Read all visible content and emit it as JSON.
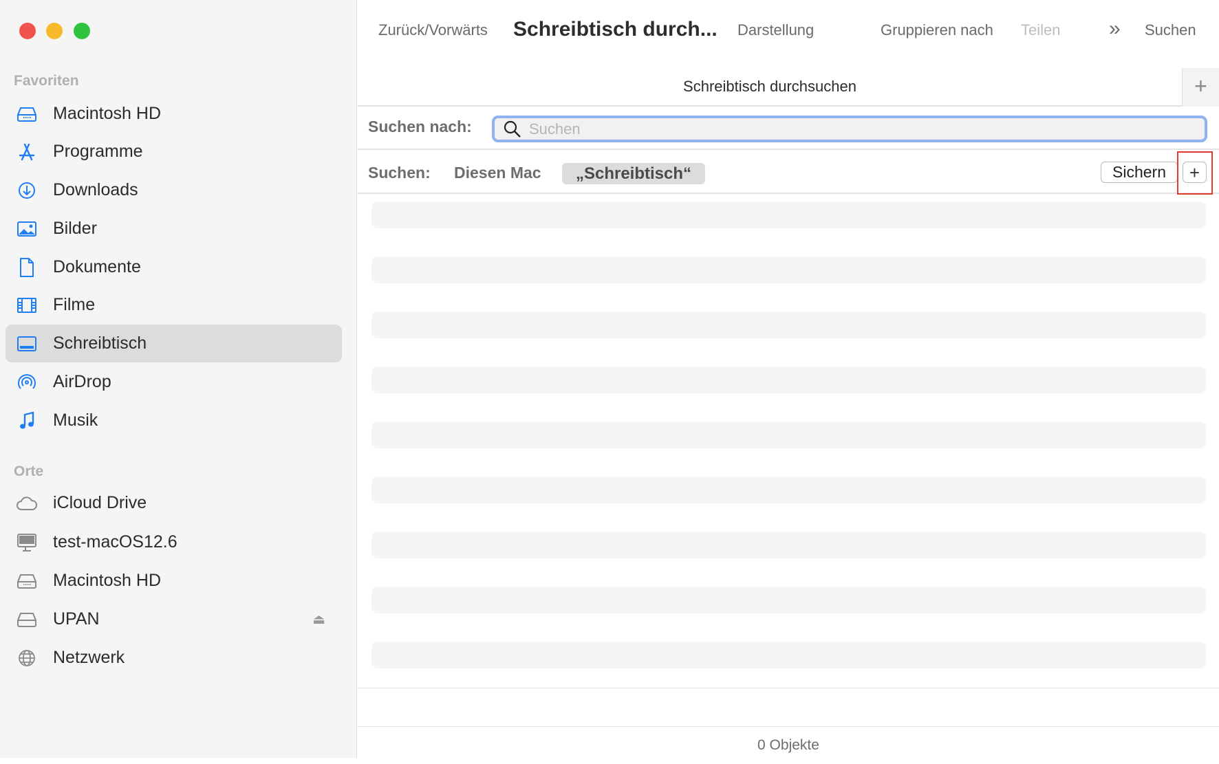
{
  "sidebar": {
    "favorites_label": "Favoriten",
    "favorites": [
      {
        "label": "Macintosh  HD",
        "icon": "internal-drive-icon"
      },
      {
        "label": "Programme",
        "icon": "applications-icon"
      },
      {
        "label": "Downloads",
        "icon": "downloads-icon"
      },
      {
        "label": "Bilder",
        "icon": "pictures-icon"
      },
      {
        "label": "Dokumente",
        "icon": "document-icon"
      },
      {
        "label": "Filme",
        "icon": "movies-icon"
      },
      {
        "label": "Schreibtisch",
        "icon": "desktop-icon",
        "selected": true
      },
      {
        "label": "AirDrop",
        "icon": "airdrop-icon"
      },
      {
        "label": "Musik",
        "icon": "music-icon"
      }
    ],
    "locations_label": "Orte",
    "locations": [
      {
        "label": "iCloud Drive",
        "icon": "cloud-icon"
      },
      {
        "label": "test-macOS12.6",
        "icon": "computer-icon"
      },
      {
        "label": "Macintosh  HD",
        "icon": "internal-drive-icon"
      },
      {
        "label": "UPAN",
        "icon": "external-drive-icon"
      },
      {
        "label": "Netzwerk",
        "icon": "network-icon"
      }
    ]
  },
  "toolbar": {
    "back_forward": "Zurück/Vorwärts",
    "title": "Schreibtisch durch...",
    "view": "Darstellung",
    "group_by": "Gruppieren nach",
    "share": "Teilen",
    "more": "»",
    "search": "Suchen"
  },
  "tab": {
    "title": "Schreibtisch durchsuchen",
    "add": "+"
  },
  "search": {
    "label": "Suchen nach:",
    "placeholder": "Suchen",
    "value": ""
  },
  "scope": {
    "label": "Suchen:",
    "this_mac": "Diesen Mac",
    "selected": "„Schreibtisch“",
    "save": "Sichern",
    "add": "+"
  },
  "status": {
    "count": "0 Objekte"
  },
  "colors": {
    "accent": "#1f7ef5",
    "focus_ring": "#8fb2f0",
    "highlight_box": "#e23a2a"
  }
}
